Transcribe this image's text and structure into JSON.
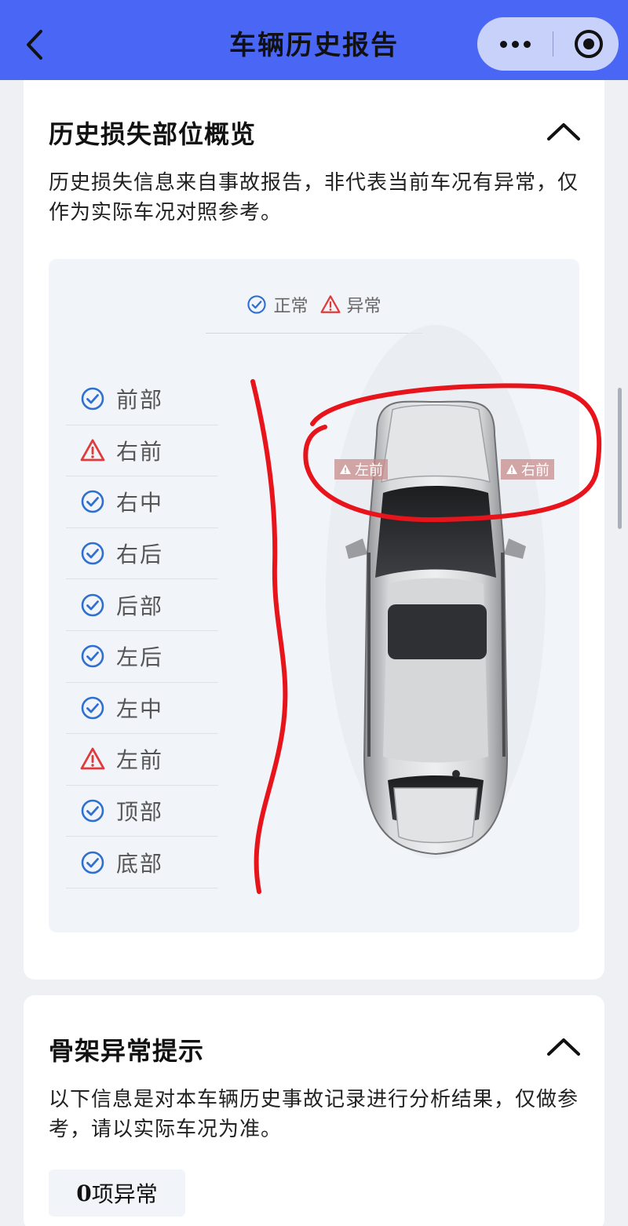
{
  "header": {
    "title": "车辆历史报告"
  },
  "damage_section": {
    "title": "历史损失部位概览",
    "description": "历史损失信息来自事故报告，非代表当前车况有异常，仅作为实际车况对照参考。",
    "legend": {
      "normal": "正常",
      "abnormal": "异常"
    },
    "parts": [
      {
        "label": "前部",
        "status": "normal"
      },
      {
        "label": "右前",
        "status": "abnormal"
      },
      {
        "label": "右中",
        "status": "normal"
      },
      {
        "label": "右后",
        "status": "normal"
      },
      {
        "label": "后部",
        "status": "normal"
      },
      {
        "label": "左后",
        "status": "normal"
      },
      {
        "label": "左中",
        "status": "normal"
      },
      {
        "label": "左前",
        "status": "abnormal"
      },
      {
        "label": "顶部",
        "status": "normal"
      },
      {
        "label": "底部",
        "status": "normal"
      }
    ],
    "car_tags": {
      "left": "左前",
      "right": "右前"
    }
  },
  "frame_section": {
    "title": "骨架异常提示",
    "description": "以下信息是对本车辆历史事故记录进行分析结果，仅做参考，请以实际车况为准。",
    "count": "0",
    "count_suffix": "项异常"
  },
  "colors": {
    "header": "#4a66f5",
    "normal_icon": "#2f6fd0",
    "abnormal_icon": "#e03a3a",
    "annotation": "#e8141c"
  }
}
